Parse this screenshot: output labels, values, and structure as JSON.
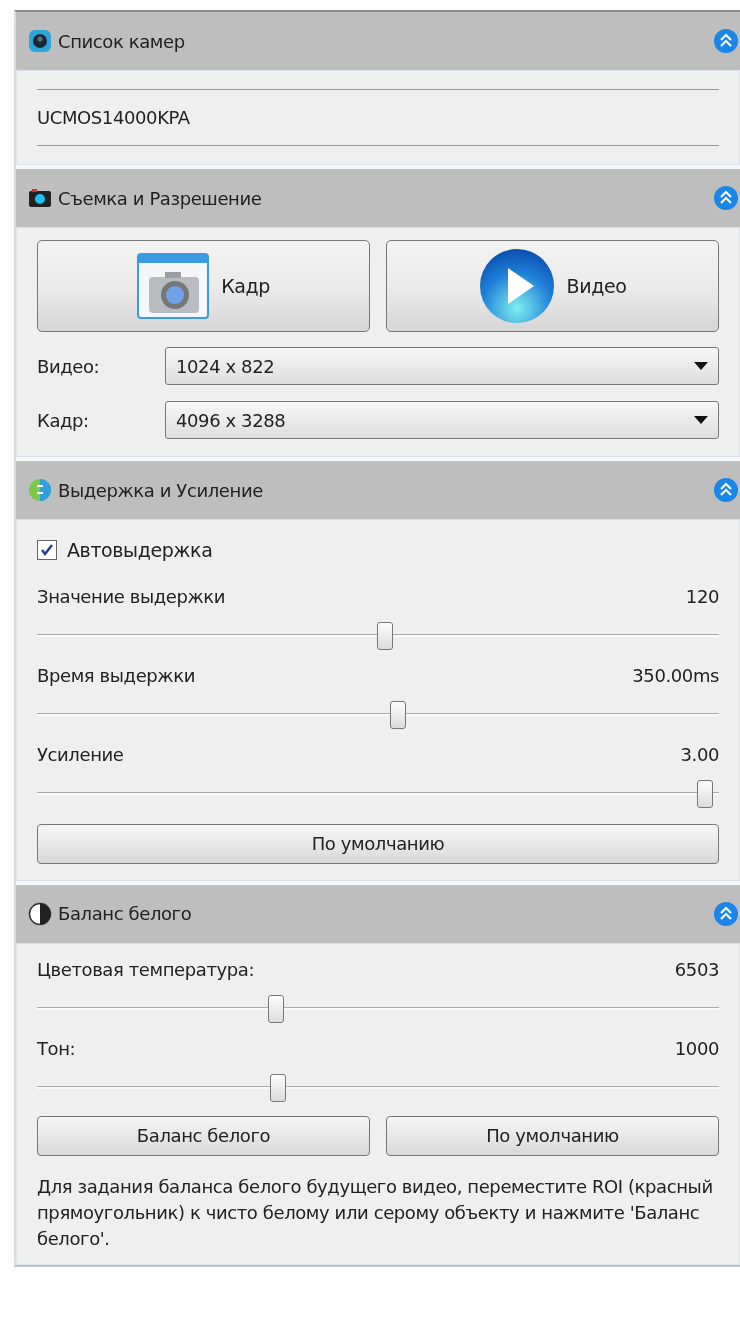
{
  "sections": [
    {
      "kind": "camera_list",
      "title": "Список камер",
      "expanded": true,
      "items": [
        {
          "kind": "list_item",
          "label": "UCMOS14000KPA",
          "selected": false
        }
      ]
    },
    {
      "kind": "capture",
      "title": "Съемка и Разрешение",
      "expanded": true,
      "items": [
        {
          "kind": "capture_buttons",
          "buttons": [
            {
              "kind": "snapshot",
              "label": "Кадр"
            },
            {
              "kind": "video",
              "label": "Видео"
            }
          ]
        },
        {
          "kind": "dropdown",
          "label": "Видео:",
          "value": "1024 x 822"
        },
        {
          "kind": "dropdown",
          "label": "Кадр:",
          "value": "4096 x 3288"
        }
      ]
    },
    {
      "kind": "exposure",
      "title": "Выдержка и Усиление",
      "expanded": true,
      "items": [
        {
          "kind": "checkbox",
          "label": "Автовыдержка",
          "checked": true
        },
        {
          "kind": "slider",
          "label": "Значение выдержки",
          "reading": "120",
          "level": 0.51
        },
        {
          "kind": "slider",
          "label": "Время выдержки",
          "reading": "350.00ms",
          "level": 0.53
        },
        {
          "kind": "slider",
          "label": "Усиление",
          "reading": "3.00",
          "level": 0.98
        },
        {
          "kind": "button",
          "label": "По умолчанию"
        }
      ]
    },
    {
      "kind": "white_balance",
      "title": "Баланс белого",
      "expanded": true,
      "items": [
        {
          "kind": "slider",
          "label": "Цветовая температура:",
          "reading": "6503",
          "level": 0.35
        },
        {
          "kind": "slider",
          "label": "Тон:",
          "reading": "1000",
          "level": 0.354
        },
        {
          "kind": "button_pair",
          "buttons": [
            {
              "label": "Баланс белого"
            },
            {
              "label": "По умолчанию"
            }
          ]
        },
        {
          "kind": "note",
          "text": "Для задания баланса белого будущего видео, переместите ROI (красный прямоугольник) к чисто белому или серому объекту и нажмите 'Баланс белого'."
        }
      ]
    }
  ]
}
